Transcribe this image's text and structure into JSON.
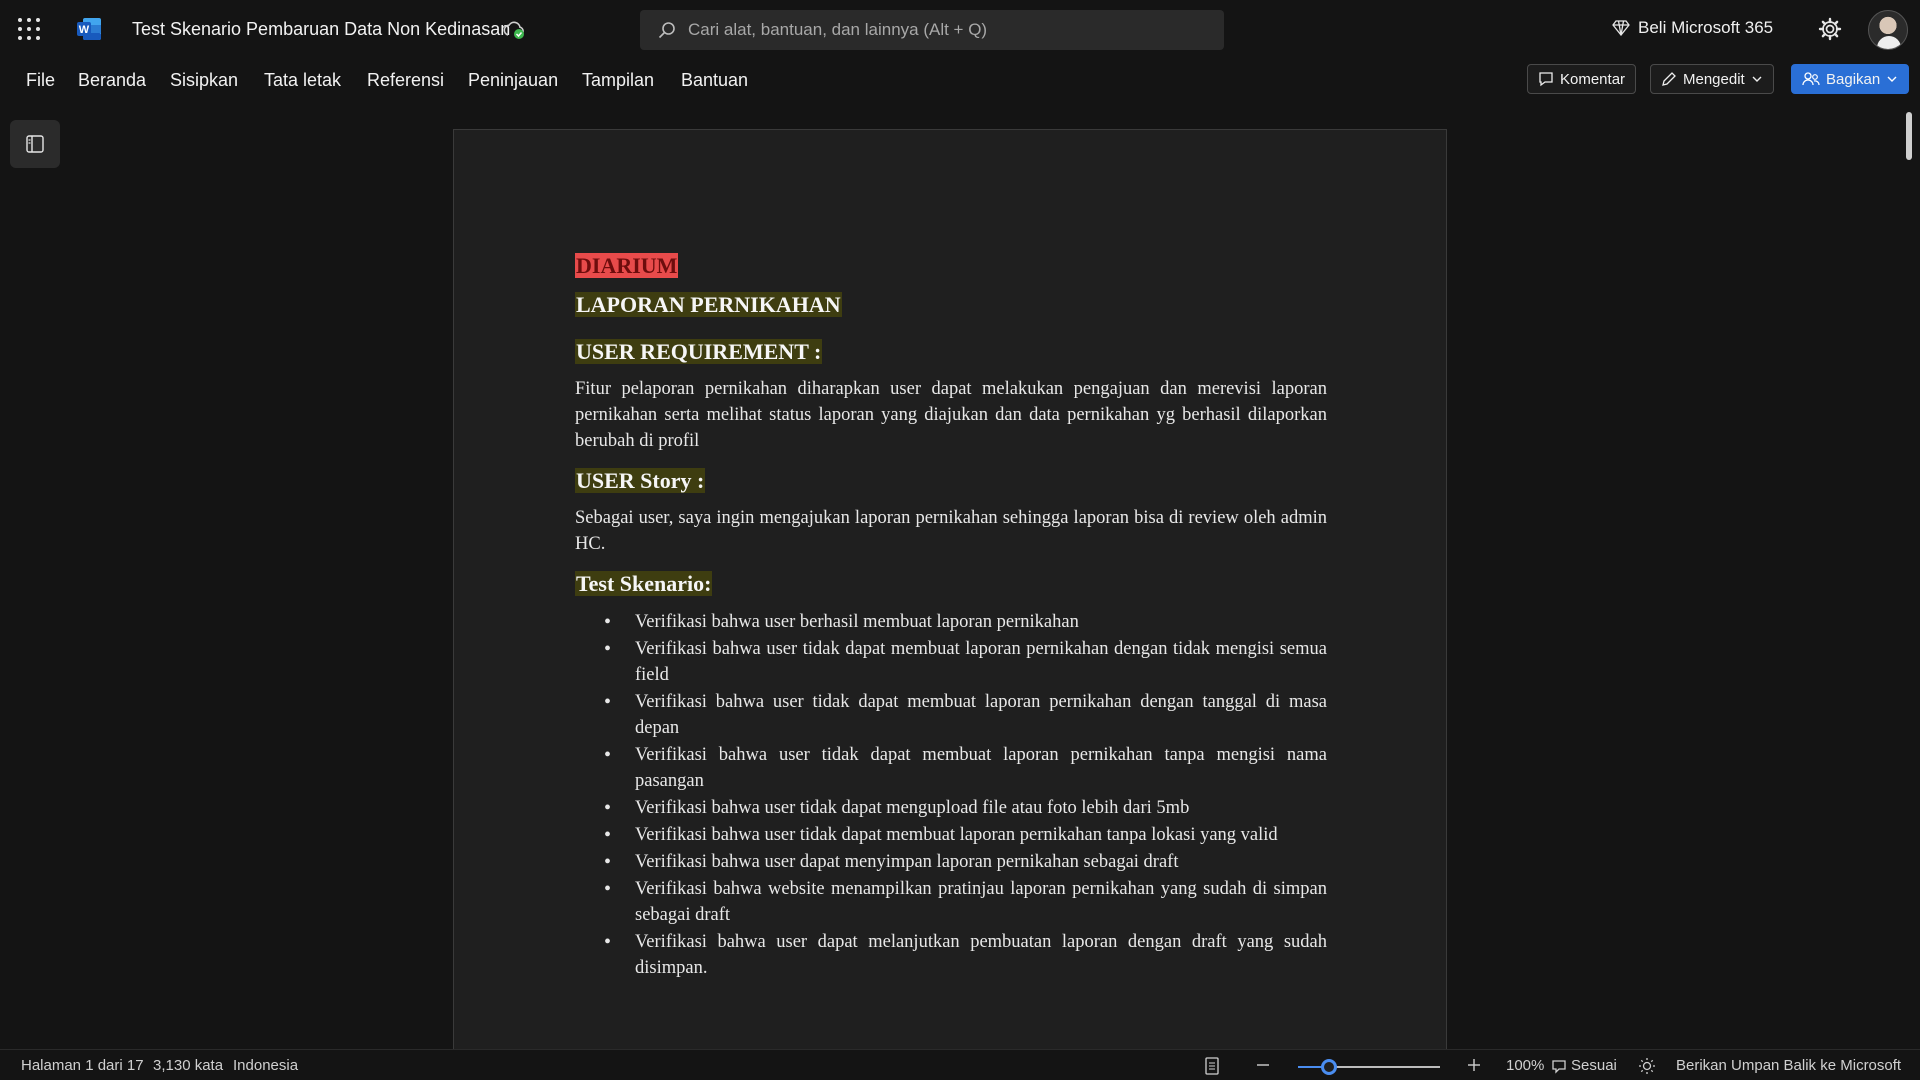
{
  "titlebar": {
    "doc_title": "Test Skenario Pembaruan Data Non Kedinasan",
    "search_placeholder": "Cari alat, bantuan, dan lainnya (Alt + Q)",
    "buy_label": "Beli Microsoft 365"
  },
  "menu": {
    "items": [
      "File",
      "Beranda",
      "Sisipkan",
      "Tata letak",
      "Referensi",
      "Peninjauan",
      "Tampilan",
      "Bantuan"
    ],
    "comment_label": "Komentar",
    "editing_label": "Mengedit",
    "share_label": "Bagikan"
  },
  "document": {
    "tag": "DIARIUM",
    "title": "LAPORAN PERNIKAHAN",
    "user_requirement_heading": "USER REQUIREMENT :",
    "user_requirement_text": "Fitur pelaporan pernikahan diharapkan user dapat melakukan pengajuan dan merevisi laporan pernikahan serta melihat status laporan yang diajukan dan data pernikahan yg berhasil dilaporkan berubah di profil",
    "user_story_heading": "USER Story :",
    "user_story_text": "Sebagai user, saya ingin mengajukan laporan pernikahan sehingga laporan bisa di review oleh admin HC.",
    "test_heading": "Test Skenario:",
    "test_items": [
      "Verifikasi bahwa user  berhasil membuat laporan pernikahan",
      "Verifikasi bahwa user tidak dapat membuat laporan pernikahan dengan tidak mengisi semua field",
      "Verifikasi bahwa user tidak dapat membuat laporan pernikahan dengan tanggal di masa depan",
      "Verifikasi bahwa user tidak dapat membuat laporan pernikahan tanpa mengisi nama pasangan",
      "Verifikasi bahwa user tidak dapat mengupload file atau foto lebih dari 5mb",
      "Verifikasi bahwa user tidak dapat membuat laporan pernikahan tanpa lokasi yang valid",
      "Verifikasi bahwa user dapat menyimpan laporan pernikahan sebagai draft",
      "Verifikasi bahwa website menampilkan pratinjau laporan pernikahan yang sudah di simpan sebagai draft",
      "Verifikasi bahwa user dapat melanjutkan pembuatan laporan dengan draft yang sudah disimpan."
    ]
  },
  "status": {
    "page": "Halaman 1 dari 17",
    "words": "3,130 kata",
    "language": "Indonesia",
    "zoom": "100%",
    "zoom_level": 0.22,
    "fit": "Sesuai",
    "feedback": "Berikan Umpan Balik ke Microsoft"
  },
  "colors": {
    "accent": "#2a6fd6",
    "highlight_red": "#e84b4b",
    "highlight_yellow": "#3e3d10"
  },
  "icons": [
    "app-launcher-icon",
    "word-logo-icon",
    "saved-cloud-icon",
    "search-icon",
    "diamond-icon",
    "gear-icon",
    "comment-icon",
    "pencil-icon",
    "share-people-icon",
    "nav-pane-icon",
    "page-view-icon",
    "zoom-out-icon",
    "zoom-in-icon",
    "fit-icon",
    "brightness-icon"
  ]
}
